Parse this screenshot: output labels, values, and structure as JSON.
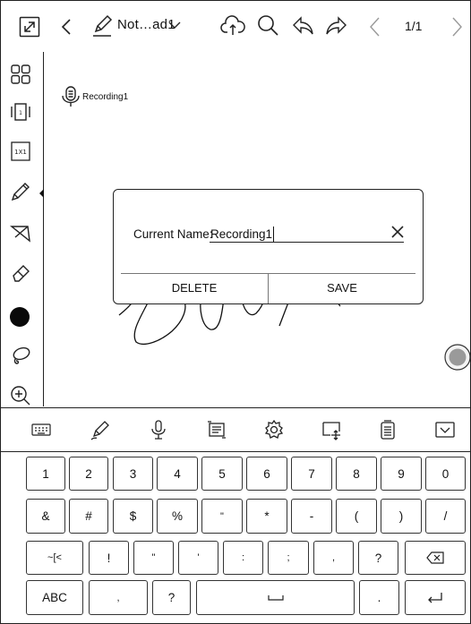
{
  "toolbar": {
    "title": "Not…ad1",
    "page_indicator": "1/1"
  },
  "canvas": {
    "recording_label": "Recording1"
  },
  "rename_dialog": {
    "label": "Current Name:",
    "value": "Recording1",
    "delete_label": "DELETE",
    "save_label": "SAVE"
  },
  "keyboard": {
    "row1": [
      "1",
      "2",
      "3",
      "4",
      "5",
      "6",
      "7",
      "8",
      "9",
      "0"
    ],
    "row2": [
      "&",
      "#",
      "$",
      "%",
      "\"",
      "*",
      "-",
      "(",
      ")",
      "/"
    ],
    "row3": [
      "~[<",
      "!",
      "\"",
      "'",
      ":",
      ";",
      ",",
      "?"
    ],
    "abc_label": "ABC",
    "row4_comma": ",",
    "row4_question": "?",
    "row4_period": "."
  }
}
